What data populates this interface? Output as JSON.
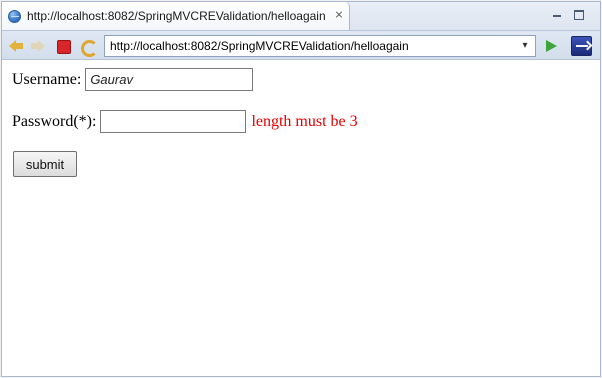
{
  "tab": {
    "title": "http://localhost:8082/SpringMVCREValidation/helloagain",
    "close_glyph": "⨯"
  },
  "toolbar": {
    "url": "http://localhost:8082/SpringMVCREValidation/helloagain",
    "dropdown_glyph": "▾"
  },
  "form": {
    "username_label": "Username:",
    "username_value": "Gaurav",
    "password_label": "Password(*):",
    "password_value": "",
    "password_error": "length must be 3",
    "submit_label": "submit"
  },
  "colors": {
    "error": "#e00000",
    "frame_border": "#a9b8cf",
    "toolbar_bg": "#d3deec"
  },
  "icons": [
    "globe-icon",
    "close-icon",
    "minimize-icon",
    "maximize-icon",
    "back-icon",
    "forward-icon",
    "stop-icon",
    "refresh-icon",
    "dropdown-icon",
    "go-icon",
    "eclipse-icon"
  ]
}
